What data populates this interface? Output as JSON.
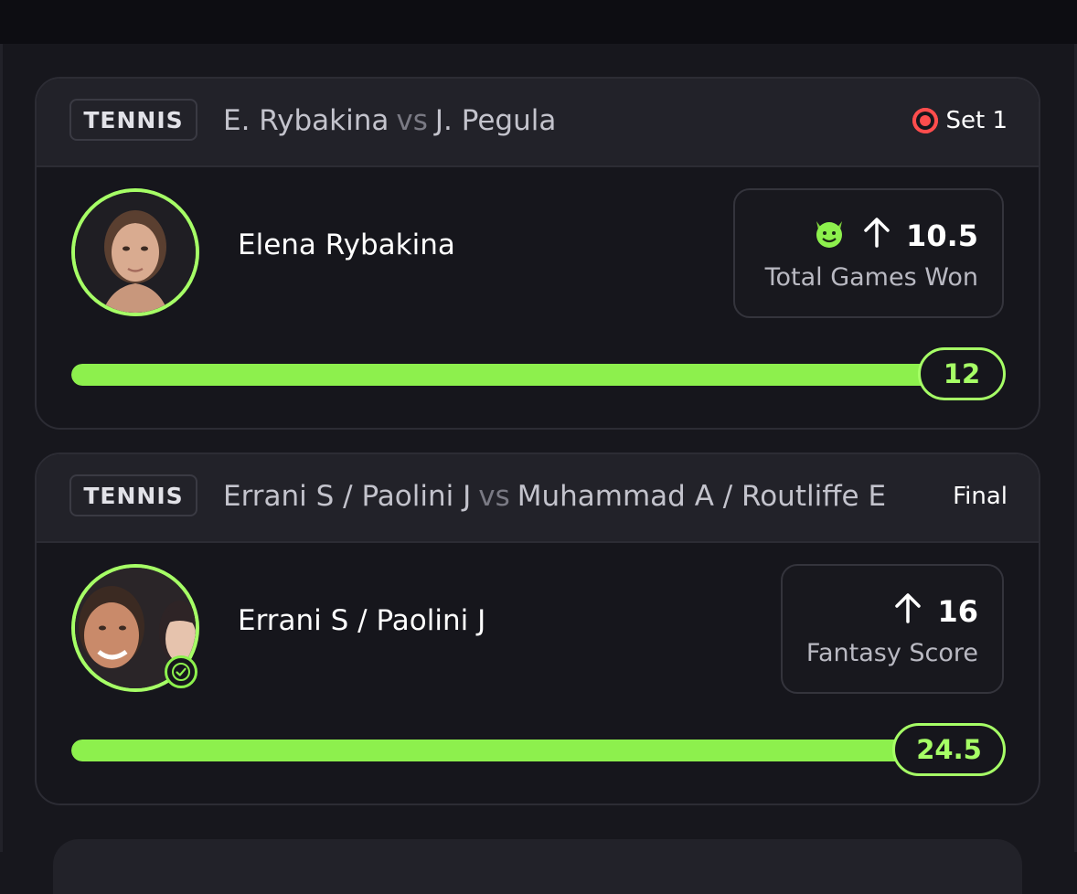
{
  "cards": [
    {
      "sport": "TENNIS",
      "matchup_left": "E. Rybakina",
      "vs": "vs",
      "matchup_right": "J. Pegula",
      "status": "Set 1",
      "live": true,
      "player_name": "Elena Rybakina",
      "stat_icons": [
        "devil-emoji-icon",
        "arrow-up-icon"
      ],
      "line": "10.5",
      "stat_label": "Total Games Won",
      "current_value": "12",
      "progress_fraction": 1.0
    },
    {
      "sport": "TENNIS",
      "matchup_left": "Errani S / Paolini J",
      "vs": "vs",
      "matchup_right": "Muhammad A / Routliffe E",
      "status": "Final",
      "live": false,
      "player_name": "Errani S / Paolini J",
      "stat_icons": [
        "arrow-up-icon"
      ],
      "line": "16",
      "stat_label": "Fantasy Score",
      "current_value": "24.5",
      "progress_fraction": 1.0,
      "completed": true
    }
  ],
  "colors": {
    "background": "#17171d",
    "card_header": "#222229",
    "accent_green": "#8df04d",
    "live_red": "#ff4d4d"
  }
}
